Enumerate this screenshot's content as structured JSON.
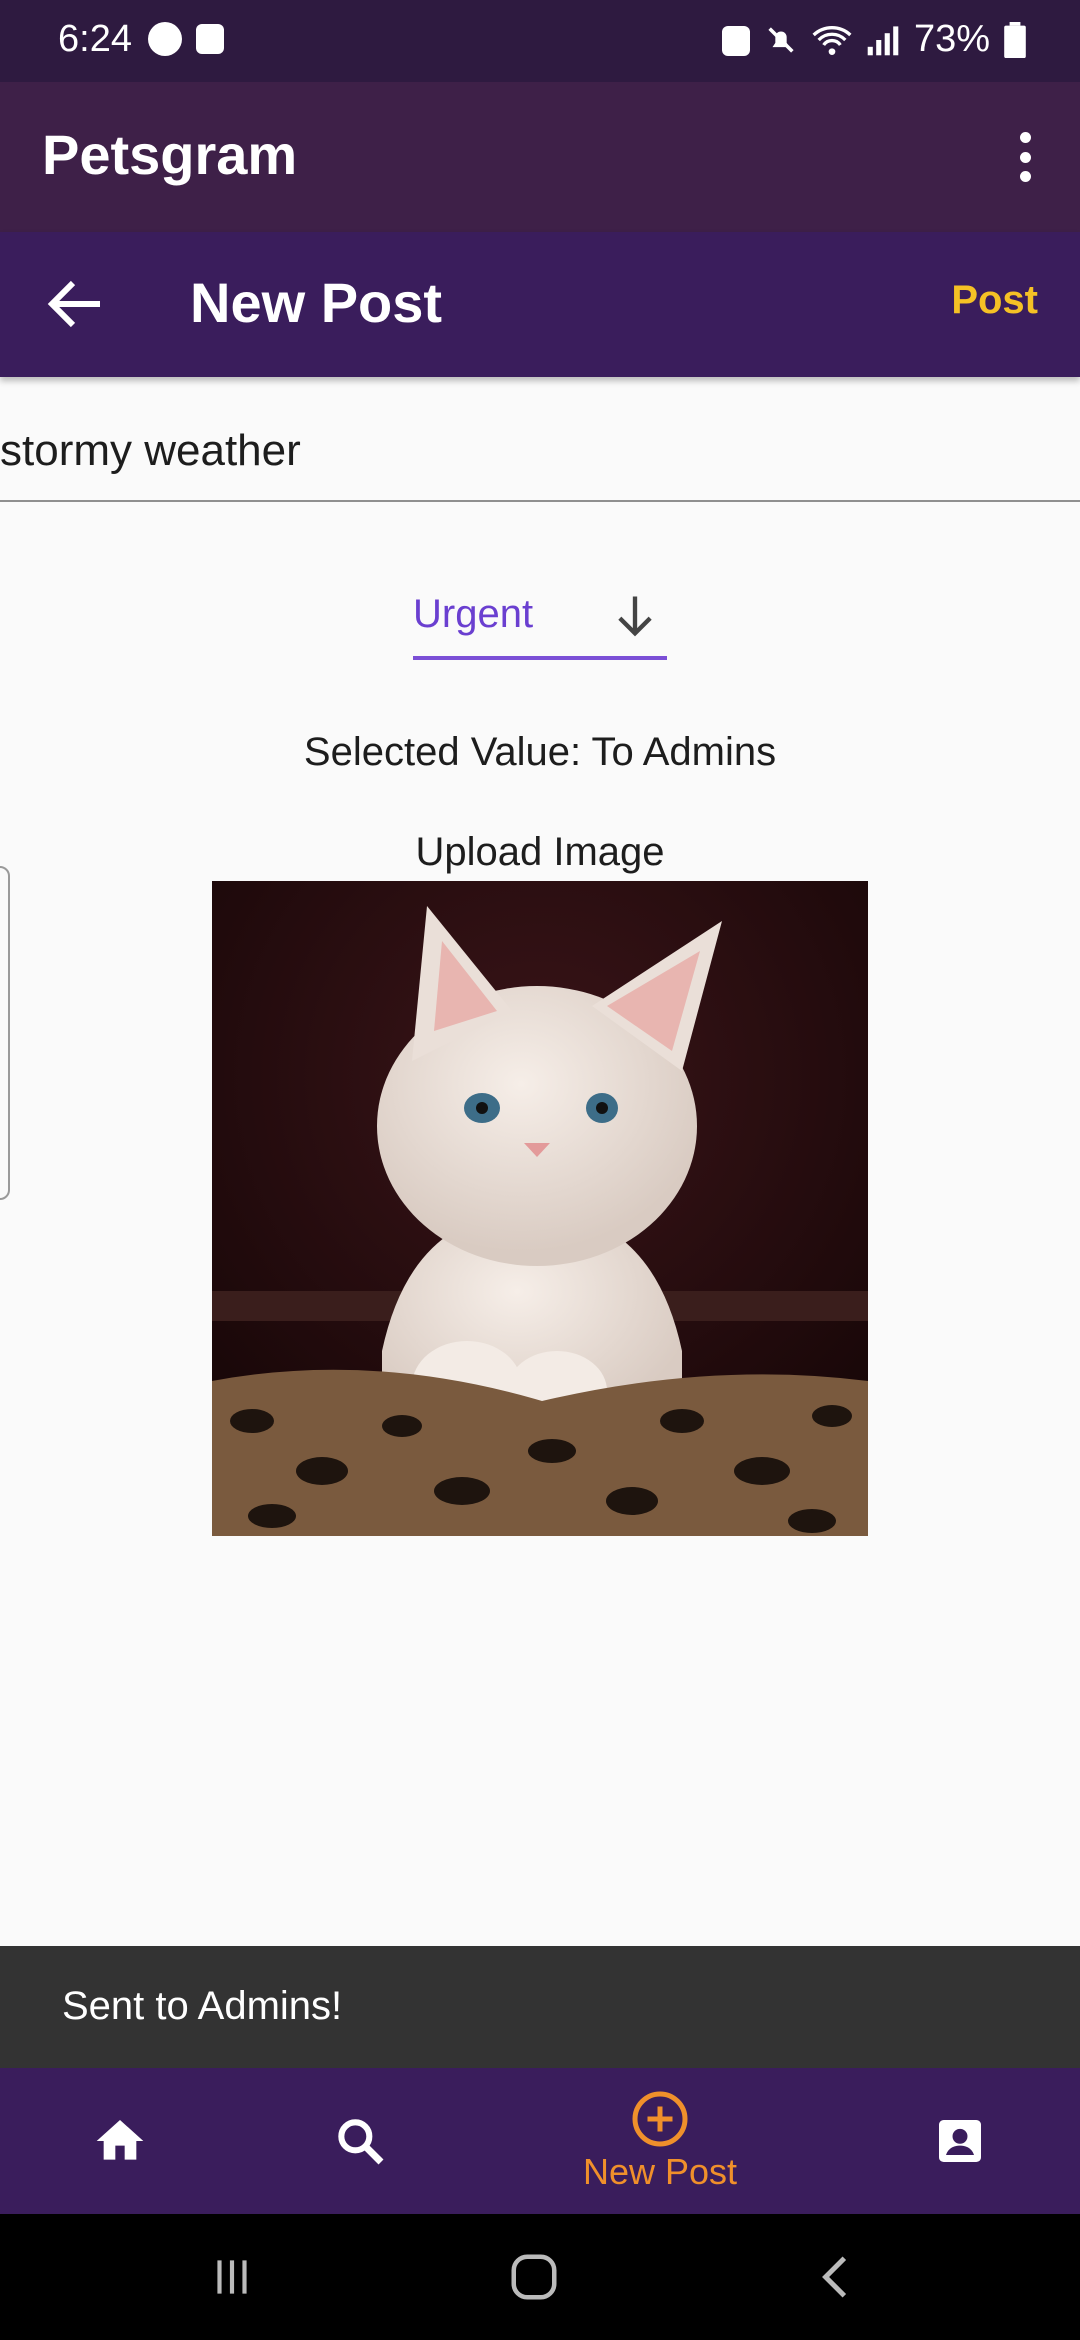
{
  "status_bar": {
    "time": "6:24",
    "battery": "73%"
  },
  "app_bar": {
    "title": "Petsgram",
    "menu_icon": "more-vert-icon"
  },
  "post_header": {
    "title": "New Post",
    "action_label": "Post",
    "back_icon": "arrow-back-icon"
  },
  "form": {
    "title_value": "stormy weather",
    "dropdown_value": "Urgent",
    "selected_value_text": "Selected Value: To Admins",
    "upload_label": "Upload Image"
  },
  "snackbar": {
    "message": "Sent to Admins!"
  },
  "bottom_nav": {
    "items": [
      {
        "icon": "home-icon",
        "label": ""
      },
      {
        "icon": "search-icon",
        "label": ""
      },
      {
        "icon": "add-circle-icon",
        "label": "New Post"
      },
      {
        "icon": "profile-icon",
        "label": ""
      }
    ]
  },
  "colors": {
    "status_bar": "#2e1a40",
    "app_bar": "#3e2048",
    "primary": "#3a1d5c",
    "accent_yellow": "#f5c125",
    "accent_orange": "#f0902b",
    "dropdown_accent": "#7b4fd6",
    "snackbar": "#333333"
  }
}
